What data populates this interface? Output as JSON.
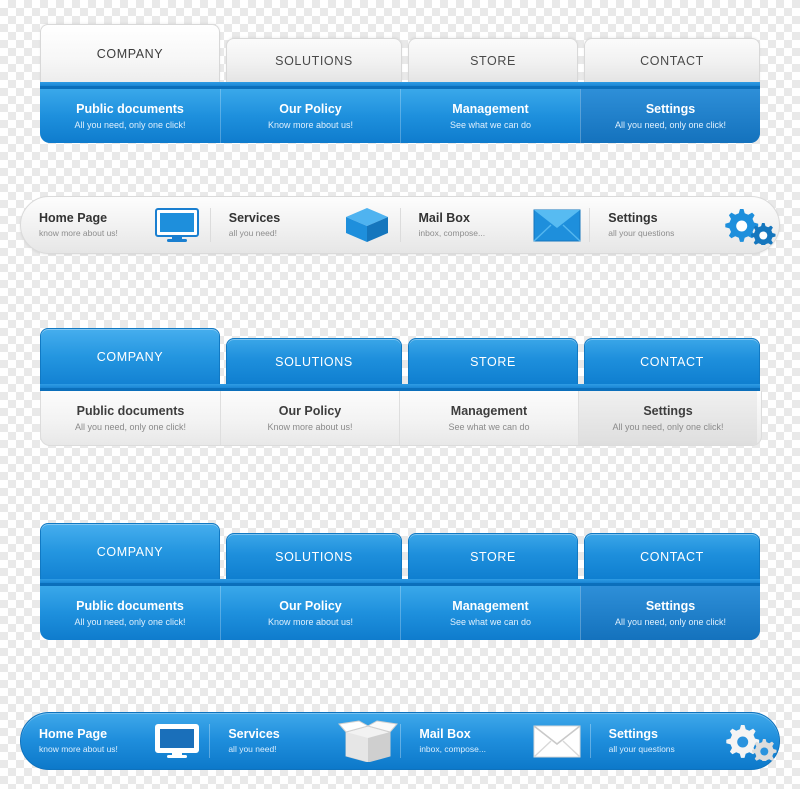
{
  "sets": {
    "set1": {
      "name": "light-tabs-blue-submenu",
      "tabs": [
        {
          "label": "COMPANY",
          "active": true
        },
        {
          "label": "SOLUTIONS",
          "active": false
        },
        {
          "label": "STORE",
          "active": false
        },
        {
          "label": "CONTACT",
          "active": false
        }
      ],
      "submenu": [
        {
          "title": "Public documents",
          "subtitle": "All you need, only one click!",
          "highlight": false
        },
        {
          "title": "Our Policy",
          "subtitle": "Know more about us!",
          "highlight": false
        },
        {
          "title": "Management",
          "subtitle": "See what we can do",
          "highlight": false
        },
        {
          "title": "Settings",
          "subtitle": "All you need, only one click!",
          "highlight": true
        }
      ]
    },
    "set2": {
      "name": "light-pill-bar",
      "items": [
        {
          "title": "Home Page",
          "subtitle": "know more about us!",
          "icon": "monitor-icon"
        },
        {
          "title": "Services",
          "subtitle": "all you need!",
          "icon": "box-icon"
        },
        {
          "title": "Mail Box",
          "subtitle": "inbox, compose...",
          "icon": "envelope-icon"
        },
        {
          "title": "Settings",
          "subtitle": "all your questions",
          "icon": "gears-icon"
        }
      ]
    },
    "set3": {
      "name": "blue-tabs-light-submenu",
      "tabs": [
        {
          "label": "COMPANY",
          "active": true
        },
        {
          "label": "SOLUTIONS",
          "active": false
        },
        {
          "label": "STORE",
          "active": false
        },
        {
          "label": "CONTACT",
          "active": false
        }
      ],
      "submenu": [
        {
          "title": "Public documents",
          "subtitle": "All you need, only one click!",
          "highlight": false
        },
        {
          "title": "Our Policy",
          "subtitle": "Know more about us!",
          "highlight": false
        },
        {
          "title": "Management",
          "subtitle": "See what we can do",
          "highlight": false
        },
        {
          "title": "Settings",
          "subtitle": "All you need, only one click!",
          "highlight": true
        }
      ]
    },
    "set4": {
      "name": "blue-tabs-blue-submenu",
      "tabs": [
        {
          "label": "COMPANY",
          "active": true
        },
        {
          "label": "SOLUTIONS",
          "active": false
        },
        {
          "label": "STORE",
          "active": false
        },
        {
          "label": "CONTACT",
          "active": false
        }
      ],
      "submenu": [
        {
          "title": "Public documents",
          "subtitle": "All you need, only one click!",
          "highlight": false
        },
        {
          "title": "Our Policy",
          "subtitle": "Know more about us!",
          "highlight": false
        },
        {
          "title": "Management",
          "subtitle": "See what we can do",
          "highlight": false
        },
        {
          "title": "Settings",
          "subtitle": "All you need, only one click!",
          "highlight": true
        }
      ]
    },
    "set5": {
      "name": "blue-pill-bar",
      "items": [
        {
          "title": "Home Page",
          "subtitle": "know more about us!",
          "icon": "monitor-icon"
        },
        {
          "title": "Services",
          "subtitle": "all you need!",
          "icon": "box-icon"
        },
        {
          "title": "Mail Box",
          "subtitle": "inbox, compose...",
          "icon": "envelope-icon"
        },
        {
          "title": "Settings",
          "subtitle": "all your questions",
          "icon": "gears-icon"
        }
      ]
    }
  },
  "colors": {
    "accent_blue": "#1e8fdc",
    "deep_blue": "#0f7ccd",
    "rule_blue": "#2f9ce4",
    "light_gray": "#f1f1f1",
    "text_dark": "#3d3d3d",
    "text_muted": "#8a8a8a"
  }
}
